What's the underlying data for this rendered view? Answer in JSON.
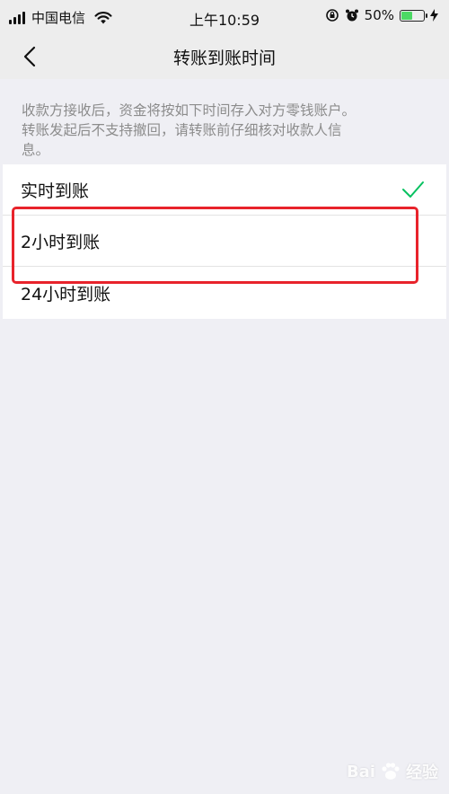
{
  "status_bar": {
    "carrier": "中国电信",
    "time": "上午10:59",
    "battery_percent": "50%",
    "battery_level": 0.5
  },
  "nav": {
    "title": "转账到账时间"
  },
  "description": {
    "line1": "收款方接收后，资金将按如下时间存入对方零钱账户。",
    "line2": "转账发起后不支持撤回，请转账前仔细核对收款人信",
    "line3": "息。"
  },
  "options": [
    {
      "label": "实时到账",
      "selected": true
    },
    {
      "label": "2小时到账",
      "selected": false
    },
    {
      "label": "24小时到账",
      "selected": false
    }
  ],
  "watermark": {
    "brand": "Bai",
    "suffix": "经验"
  },
  "colors": {
    "check": "#07c160",
    "highlight": "#e8232b",
    "battery": "#4cd964"
  }
}
